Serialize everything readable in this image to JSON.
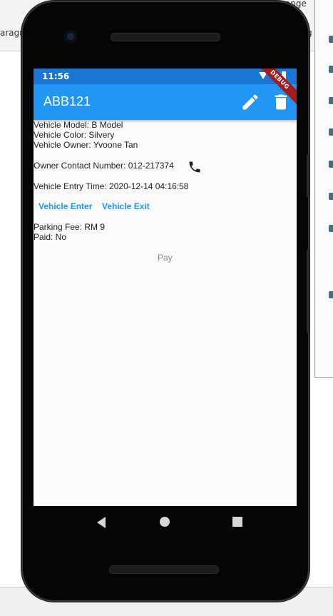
{
  "background": {
    "toolbar_text_left": "aragra",
    "toolbar_text_right": "range",
    "toolbar_text_right2": "g"
  },
  "status_bar": {
    "time": "11:56"
  },
  "app_bar": {
    "title": "ABB121",
    "edit_icon": "pencil-icon",
    "delete_icon": "trash-icon",
    "debug_banner": "DEBUG"
  },
  "vehicle": {
    "model": "Vehicle Model: B Model",
    "color": "Vehicle Color: Silvery",
    "owner": "Vehicle Owner: Yvoone Tan",
    "contact": "Owner Contact Number: 012-217374",
    "entry_time": "Vehicle Entry Time: 2020-12-14 04:16:58"
  },
  "actions": {
    "enter": "Vehicle Enter",
    "exit": "Vehicle Exit"
  },
  "payment": {
    "fee": "Parking Fee: RM 9",
    "paid": "Paid: No",
    "pay_label": "Pay"
  },
  "colors": {
    "primary": "#2196f3",
    "status_bar": "#1976d2",
    "debug": "#a41b1b"
  }
}
